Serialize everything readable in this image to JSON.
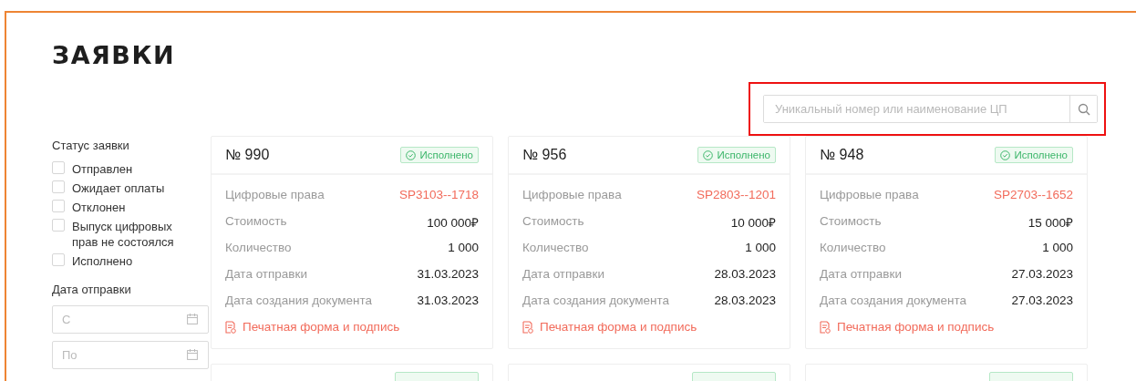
{
  "title": "ЗАЯВКИ",
  "search": {
    "placeholder": "Уникальный номер или наименование ЦП",
    "highlighted": true
  },
  "filters": {
    "status_title": "Статус заявки",
    "statuses": [
      {
        "label": "Отправлен",
        "checked": false
      },
      {
        "label": "Ожидает оплаты",
        "checked": false
      },
      {
        "label": "Отклонен",
        "checked": false
      },
      {
        "label": "Выпуск цифровых прав не состоялся",
        "checked": false
      },
      {
        "label": "Исполнено",
        "checked": false
      }
    ],
    "date_title": "Дата отправки",
    "date_fields": [
      {
        "placeholder": "С"
      },
      {
        "placeholder": "По"
      }
    ]
  },
  "cards": [
    {
      "number": "№ 990",
      "status": "Исполнено",
      "rows": [
        {
          "label": "Цифровые права",
          "value": "SP3103--1718",
          "kind": "link"
        },
        {
          "label": "Стоимость",
          "value": "100 000₽",
          "kind": "text"
        },
        {
          "label": "Количество",
          "value": "1 000",
          "kind": "text"
        },
        {
          "label": "Дата отправки",
          "value": "31.03.2023",
          "kind": "text"
        },
        {
          "label": "Дата создания документа",
          "value": "31.03.2023",
          "kind": "text"
        }
      ],
      "action": "Печатная форма и подпись"
    },
    {
      "number": "№ 956",
      "status": "Исполнено",
      "rows": [
        {
          "label": "Цифровые права",
          "value": "SP2803--1201",
          "kind": "link"
        },
        {
          "label": "Стоимость",
          "value": "10 000₽",
          "kind": "text"
        },
        {
          "label": "Количество",
          "value": "1 000",
          "kind": "text"
        },
        {
          "label": "Дата отправки",
          "value": "28.03.2023",
          "kind": "text"
        },
        {
          "label": "Дата создания документа",
          "value": "28.03.2023",
          "kind": "text"
        }
      ],
      "action": "Печатная форма и подпись"
    },
    {
      "number": "№ 948",
      "status": "Исполнено",
      "rows": [
        {
          "label": "Цифровые права",
          "value": "SP2703--1652",
          "kind": "link"
        },
        {
          "label": "Стоимость",
          "value": "15 000₽",
          "kind": "text"
        },
        {
          "label": "Количество",
          "value": "1 000",
          "kind": "text"
        },
        {
          "label": "Дата отправки",
          "value": "27.03.2023",
          "kind": "text"
        },
        {
          "label": "Дата создания документа",
          "value": "27.03.2023",
          "kind": "text"
        }
      ],
      "action": "Печатная форма и подпись"
    }
  ]
}
